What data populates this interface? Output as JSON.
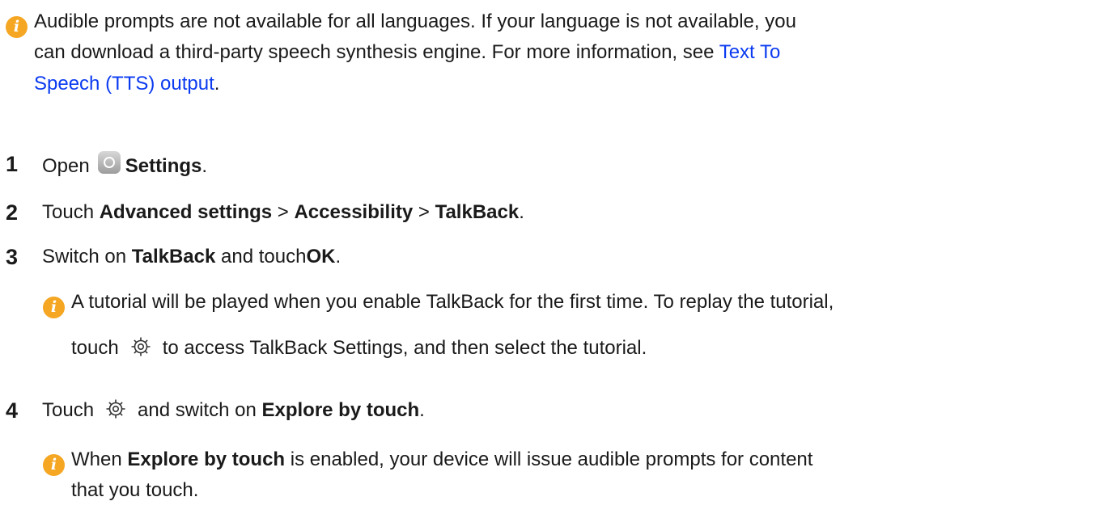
{
  "intro_note": {
    "line1": "Audible prompts are not available for all languages. If your language is not available, you",
    "line2_text": "can download a third-party speech synthesis engine. For more information, see ",
    "link_part1": "Text To",
    "link_part2": "Speech (TTS) output",
    "line3_suffix": "."
  },
  "steps": [
    {
      "number": "1",
      "prefix": "Open",
      "icon": "settings-app-icon",
      "bold1": "Settings",
      "suffix": "."
    },
    {
      "number": "2",
      "prefix": "Touch ",
      "bold1": "Advanced settings",
      "sep1": " > ",
      "bold2": "Accessibility",
      "sep2": " > ",
      "bold3": "TalkBack",
      "suffix": "."
    },
    {
      "number": "3",
      "prefix": "Switch on ",
      "bold1": "TalkBack",
      "middle": " and touch",
      "bold2": "OK",
      "suffix": ".",
      "note": {
        "line1": "A tutorial will be played when you enable TalkBack for the first time. To replay the tutorial,",
        "line2_prefix": "touch",
        "icon": "gear-icon",
        "line2_suffix": "to access TalkBack Settings, and then select the tutorial."
      }
    },
    {
      "number": "4",
      "prefix": "Touch",
      "icon": "gear-icon",
      "middle": "and switch on ",
      "bold1": "Explore by touch",
      "suffix": ".",
      "note": {
        "prefix": "When ",
        "bold1": "Explore by touch",
        "line1_suffix": " is enabled, your device will issue audible prompts for content",
        "line2": "that you touch."
      }
    }
  ],
  "info_icon_glyph": "i"
}
